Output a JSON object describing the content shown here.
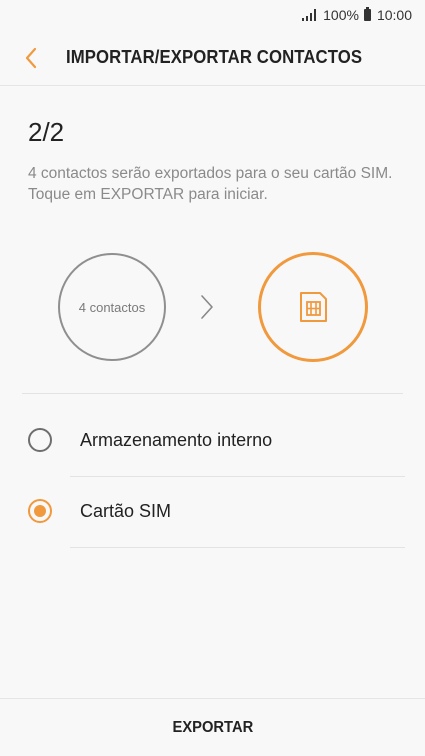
{
  "status_bar": {
    "battery_text": "100%",
    "time": "10:00",
    "icons": [
      "signal-icon",
      "battery-icon"
    ]
  },
  "header": {
    "back_icon": "back-arrow-icon",
    "title": "IMPORTAR/EXPORTAR CONTACTOS"
  },
  "main": {
    "step": "2/2",
    "description": "4 contactos serão exportados para o seu cartão SIM. Toque em EXPORTAR para iniciar.",
    "source_label": "4 contactos",
    "arrow_icon": "chevron-right-icon",
    "target_icon": "sim-card-icon"
  },
  "options": [
    {
      "label": "Armazenamento interno",
      "selected": false
    },
    {
      "label": "Cartão SIM",
      "selected": true
    }
  ],
  "footer": {
    "export_label": "EXPORTAR"
  },
  "colors": {
    "accent": "#f0993d",
    "background": "#f8f8f8"
  }
}
